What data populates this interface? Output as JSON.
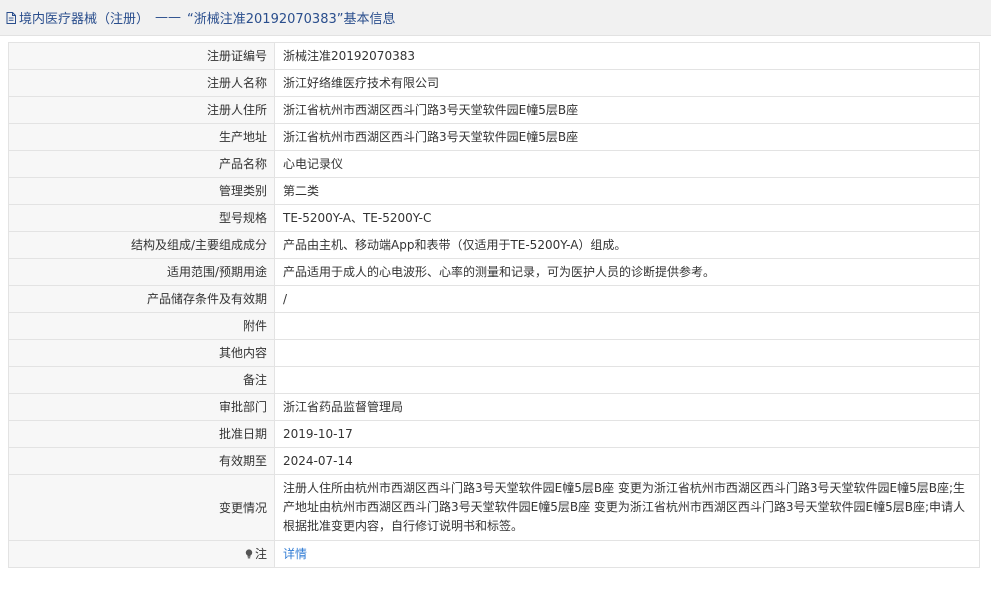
{
  "header": {
    "category": "境内医疗器械（注册）",
    "separator": "——",
    "title": "“浙械注准20192070383”基本信息",
    "icon": "document-icon"
  },
  "rows": [
    {
      "label": "注册证编号",
      "value": "浙械注准20192070383"
    },
    {
      "label": "注册人名称",
      "value": "浙江好络维医疗技术有限公司"
    },
    {
      "label": "注册人住所",
      "value": "浙江省杭州市西湖区西斗门路3号天堂软件园E幢5层B座"
    },
    {
      "label": "生产地址",
      "value": "浙江省杭州市西湖区西斗门路3号天堂软件园E幢5层B座"
    },
    {
      "label": "产品名称",
      "value": "心电记录仪"
    },
    {
      "label": "管理类别",
      "value": "第二类"
    },
    {
      "label": "型号规格",
      "value": "TE-5200Y-A、TE-5200Y-C"
    },
    {
      "label": "结构及组成/主要组成成分",
      "value": "产品由主机、移动端App和表带（仅适用于TE-5200Y-A）组成。"
    },
    {
      "label": "适用范围/预期用途",
      "value": "产品适用于成人的心电波形、心率的测量和记录，可为医护人员的诊断提供参考。"
    },
    {
      "label": "产品储存条件及有效期",
      "value": "/"
    },
    {
      "label": "附件",
      "value": ""
    },
    {
      "label": "其他内容",
      "value": ""
    },
    {
      "label": "备注",
      "value": ""
    },
    {
      "label": "审批部门",
      "value": "浙江省药品监督管理局"
    },
    {
      "label": "批准日期",
      "value": "2019-10-17"
    },
    {
      "label": "有效期至",
      "value": "2024-07-14"
    },
    {
      "label": "变更情况",
      "value": "注册人住所由杭州市西湖区西斗门路3号天堂软件园E幢5层B座 变更为浙江省杭州市西湖区西斗门路3号天堂软件园E幢5层B座;生产地址由杭州市西湖区西斗门路3号天堂软件园E幢5层B座 变更为浙江省杭州市西湖区西斗门路3号天堂软件园E幢5层B座;申请人根据批准变更内容，自行修订说明书和标签。"
    }
  ],
  "note": {
    "label": "注",
    "icon": "lightbulb-icon",
    "link_text": "详情"
  },
  "colors": {
    "title_text": "#2a4e8d",
    "title_bg": "#f1f1f1",
    "label_bg": "#f7f7f7",
    "border": "#e3e3e3",
    "link": "#2f7bd4"
  }
}
